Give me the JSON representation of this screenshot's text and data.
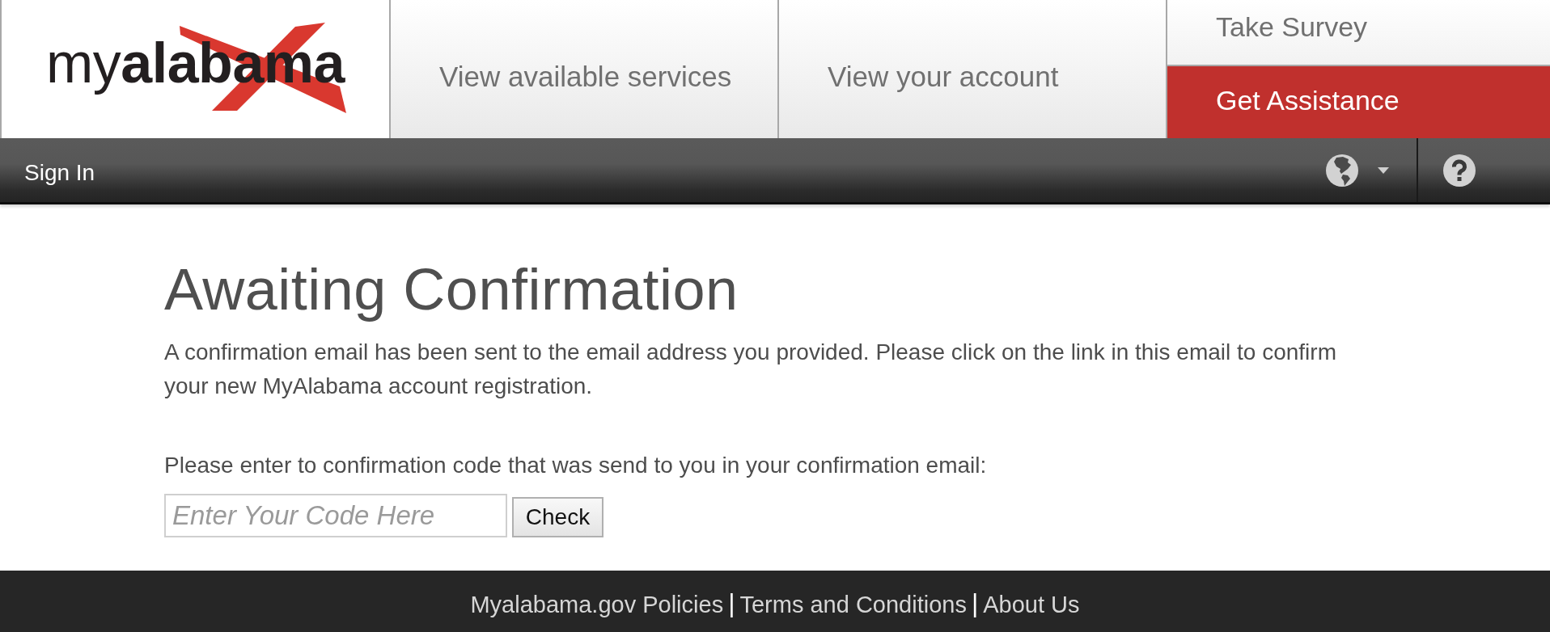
{
  "logo": {
    "wordmark": "my**alabama**"
  },
  "nav": {
    "tabs": [
      {
        "label": "View available services"
      },
      {
        "label": "View your account"
      }
    ],
    "side_links": [
      {
        "label": "Take Survey",
        "kind": "plain"
      },
      {
        "label": "Get Assistance",
        "kind": "accent"
      }
    ]
  },
  "toolbar": {
    "sign_in": "Sign In"
  },
  "content": {
    "title": "Awaiting Confirmation",
    "message": "A confirmation email has been sent to the email address you provided. Please click on the link in this email to confirm your new MyAlabama account registration.",
    "prompt": "Please enter to confirmation code that was send to you in your confirmation email:",
    "code_field": {
      "placeholder": "Enter Your Code Here"
    },
    "check_button": "Check"
  },
  "footer": {
    "items": [
      {
        "kind": "link",
        "text": "Myalabama.gov Policies"
      },
      {
        "kind": "separator",
        "text": "|"
      },
      {
        "kind": "link",
        "text": "Terms and Conditions"
      },
      {
        "kind": "separator",
        "text": "|"
      },
      {
        "kind": "link",
        "text": "About Us"
      }
    ]
  }
}
